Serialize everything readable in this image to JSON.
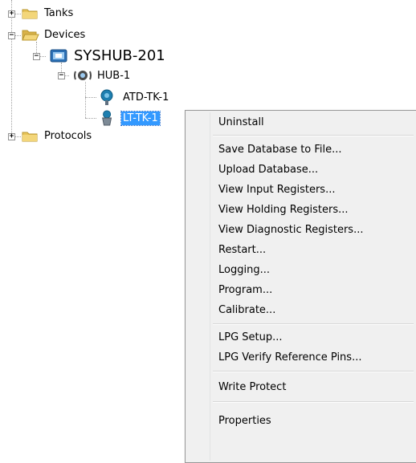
{
  "tree": {
    "tanks": "Tanks",
    "devices": "Devices",
    "syshub": "SYSHUB-201",
    "hub": "HUB-1",
    "atd": "ATD-TK-1",
    "lt": "LT-TK-1",
    "protocols": "Protocols",
    "expanders": {
      "collapsed": "+",
      "expanded": "−"
    }
  },
  "context_menu": {
    "items": [
      "Uninstall",
      "Save Database to File...",
      "Upload Database...",
      "View Input Registers...",
      "View Holding Registers...",
      "View Diagnostic Registers...",
      "Restart...",
      "Logging...",
      "Program...",
      "Calibrate...",
      "LPG Setup...",
      "LPG Verify Reference Pins...",
      "Write Protect",
      "Properties"
    ]
  },
  "colors": {
    "selection": "#3399ff",
    "folder": "#e8c45a",
    "menu_bg": "#f0f0f0"
  }
}
